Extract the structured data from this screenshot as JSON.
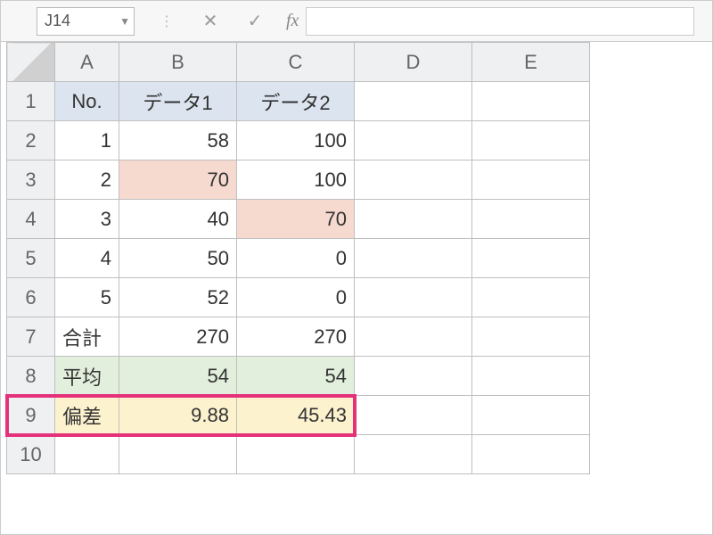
{
  "name_box": "J14",
  "fx_label": "fx",
  "col_headers": [
    "A",
    "B",
    "C",
    "D",
    "E"
  ],
  "row_headers": [
    "1",
    "2",
    "3",
    "4",
    "5",
    "6",
    "7",
    "8",
    "9",
    "10"
  ],
  "table": {
    "r1": {
      "A": "No.",
      "B": "データ1",
      "C": "データ2"
    },
    "r2": {
      "A": "1",
      "B": "58",
      "C": "100"
    },
    "r3": {
      "A": "2",
      "B": "70",
      "C": "100"
    },
    "r4": {
      "A": "3",
      "B": "40",
      "C": "70"
    },
    "r5": {
      "A": "4",
      "B": "50",
      "C": "0"
    },
    "r6": {
      "A": "5",
      "B": "52",
      "C": "0"
    },
    "r7": {
      "A": "合計",
      "B": "270",
      "C": "270"
    },
    "r8": {
      "A": "平均",
      "B": "54",
      "C": "54"
    },
    "r9": {
      "A": "偏差",
      "B": "9.88",
      "C": "45.43"
    }
  },
  "chart_data": {
    "type": "table",
    "title": "",
    "columns": [
      "No.",
      "データ1",
      "データ2"
    ],
    "rows": [
      [
        "1",
        58,
        100
      ],
      [
        "2",
        70,
        100
      ],
      [
        "3",
        40,
        70
      ],
      [
        "4",
        50,
        0
      ],
      [
        "5",
        52,
        0
      ],
      [
        "合計",
        270,
        270
      ],
      [
        "平均",
        54,
        54
      ],
      [
        "偏差",
        9.88,
        45.43
      ]
    ]
  }
}
